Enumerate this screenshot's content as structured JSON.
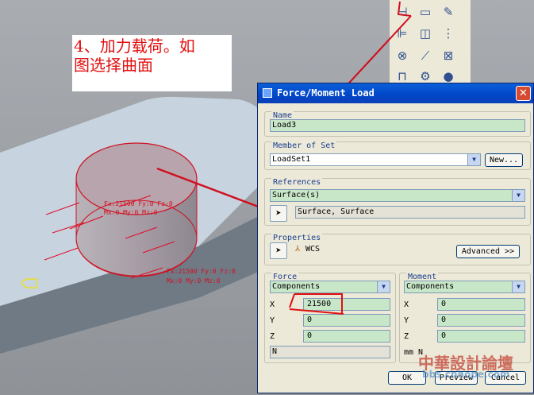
{
  "annotation": {
    "line1": "4、加力载荷。如",
    "line2": "图选择曲面"
  },
  "model": {
    "label1_line1": "Fx:21500 Fy:0 Fz:0",
    "label1_line2": "Mx:0 My:0 Mz:0",
    "label2_line1": "Fx:21500 Fy:0 Fz:0",
    "label2_line2": "Mx:0 My:0 Mz:0"
  },
  "dialog": {
    "title": "Force/Moment Load",
    "name_group": "Name",
    "name_value": "Load3",
    "member_group": "Member of Set",
    "member_value": "LoadSet1",
    "new_button": "New...",
    "references_group": "References",
    "references_type": "Surface(s)",
    "references_value": "Surface, Surface",
    "properties_group": "Properties",
    "properties_csys": "WCS",
    "advanced_button": "Advanced >>",
    "force_group": "Force",
    "force_mode": "Components",
    "force_x": "21500",
    "force_y": "0",
    "force_z": "0",
    "force_units": "N",
    "moment_group": "Moment",
    "moment_mode": "Components",
    "moment_x": "0",
    "moment_y": "0",
    "moment_z": "0",
    "moment_units": "mm N",
    "label_x": "X",
    "label_y": "Y",
    "label_z": "Z",
    "ok_button": "OK",
    "preview_button": "Preview",
    "cancel_button": "Cancel"
  },
  "watermark": {
    "main": "中華設計論壇",
    "sub": "bbs.cnhope.com"
  },
  "colors": {
    "annotation_red": "#e01010",
    "field_green": "#c8e6c8",
    "titlebar_blue": "#0046c8",
    "model_surface": "#c5d3df"
  },
  "icons": [
    "force-load-icon",
    "load-tag-icon",
    "edit-icon",
    "constraint-icon",
    "measure-icon",
    "ruler-icon",
    "close-box-icon",
    "pin-icon",
    "sphere-icon"
  ]
}
